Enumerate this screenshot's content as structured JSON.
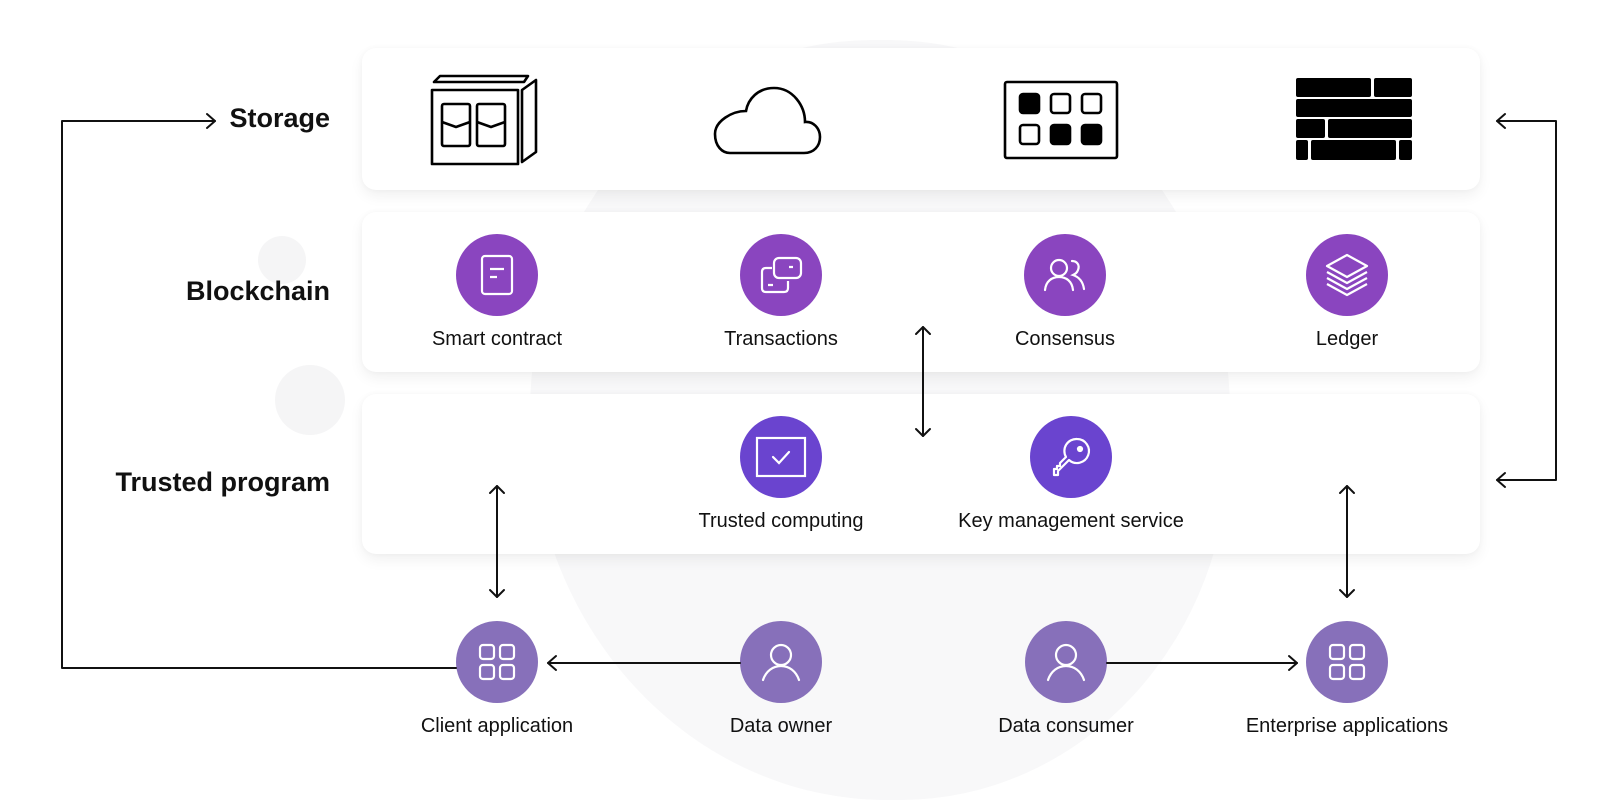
{
  "colors": {
    "blockchain_purple": "#8A45BF",
    "trusted_purple": "#6A44CF",
    "app_purple": "#8770BA",
    "line": "#111111"
  },
  "layers": {
    "storage": {
      "label": "Storage",
      "icons": [
        "server-cabinet-icon",
        "cloud-icon",
        "grid-storage-icon",
        "brick-wall-icon"
      ]
    },
    "blockchain": {
      "label": "Blockchain",
      "items": [
        {
          "label": "Smart contract",
          "icon": "document-icon"
        },
        {
          "label": "Transactions",
          "icon": "transfer-cards-icon"
        },
        {
          "label": "Consensus",
          "icon": "users-icon"
        },
        {
          "label": "Ledger",
          "icon": "layers-icon"
        }
      ]
    },
    "trusted_program": {
      "label": "Trusted program",
      "items": [
        {
          "label": "Trusted computing",
          "icon": "monitor-check-icon"
        },
        {
          "label": "Key management service",
          "icon": "key-icon"
        }
      ]
    },
    "applications": {
      "items": [
        {
          "label": "Client application",
          "icon": "apps-grid-icon"
        },
        {
          "label": "Data owner",
          "icon": "user-icon"
        },
        {
          "label": "Data consumer",
          "icon": "user-icon"
        },
        {
          "label": "Enterprise applications",
          "icon": "apps-grid-icon"
        }
      ]
    }
  }
}
